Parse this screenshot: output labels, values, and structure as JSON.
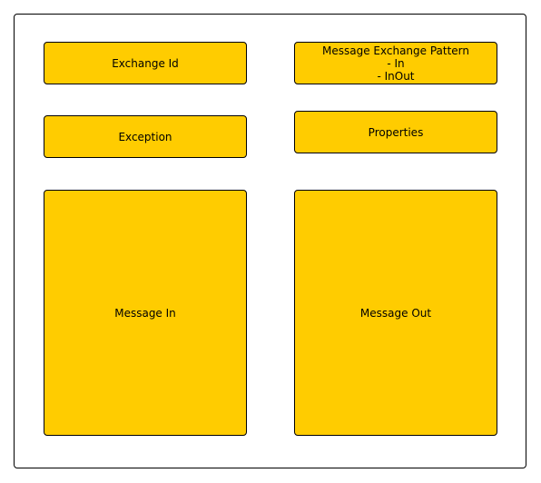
{
  "diagram": {
    "boxes": {
      "exchange_id": "Exchange Id",
      "message_exchange_pattern": {
        "title": "Message Exchange Pattern",
        "items": [
          "- In",
          "- InOut"
        ]
      },
      "exception": "Exception",
      "properties": "Properties",
      "message_in": "Message In",
      "message_out": "Message Out"
    },
    "colors": {
      "box_fill": "#ffcc00",
      "border": "#000000",
      "background": "#ffffff"
    }
  }
}
